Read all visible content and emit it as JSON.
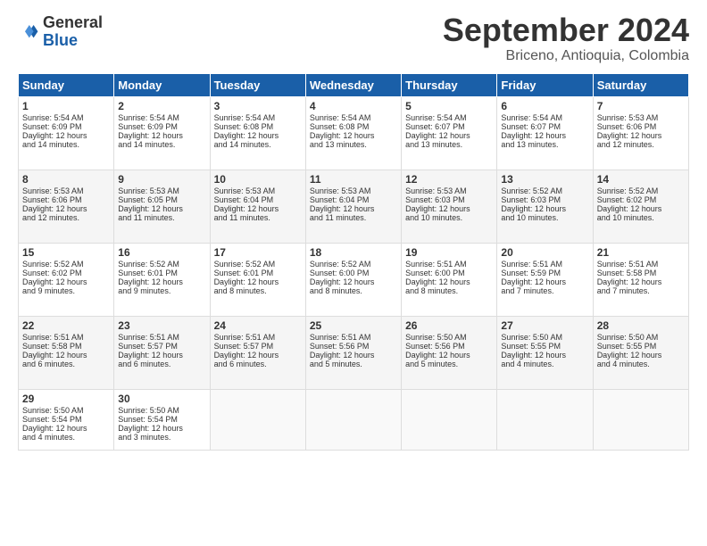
{
  "header": {
    "logo_line1": "General",
    "logo_line2": "Blue",
    "month": "September 2024",
    "location": "Briceno, Antioquia, Colombia"
  },
  "weekdays": [
    "Sunday",
    "Monday",
    "Tuesday",
    "Wednesday",
    "Thursday",
    "Friday",
    "Saturday"
  ],
  "weeks": [
    [
      {
        "day": "1",
        "lines": [
          "Sunrise: 5:54 AM",
          "Sunset: 6:09 PM",
          "Daylight: 12 hours",
          "and 14 minutes."
        ]
      },
      {
        "day": "2",
        "lines": [
          "Sunrise: 5:54 AM",
          "Sunset: 6:09 PM",
          "Daylight: 12 hours",
          "and 14 minutes."
        ]
      },
      {
        "day": "3",
        "lines": [
          "Sunrise: 5:54 AM",
          "Sunset: 6:08 PM",
          "Daylight: 12 hours",
          "and 14 minutes."
        ]
      },
      {
        "day": "4",
        "lines": [
          "Sunrise: 5:54 AM",
          "Sunset: 6:08 PM",
          "Daylight: 12 hours",
          "and 13 minutes."
        ]
      },
      {
        "day": "5",
        "lines": [
          "Sunrise: 5:54 AM",
          "Sunset: 6:07 PM",
          "Daylight: 12 hours",
          "and 13 minutes."
        ]
      },
      {
        "day": "6",
        "lines": [
          "Sunrise: 5:54 AM",
          "Sunset: 6:07 PM",
          "Daylight: 12 hours",
          "and 13 minutes."
        ]
      },
      {
        "day": "7",
        "lines": [
          "Sunrise: 5:53 AM",
          "Sunset: 6:06 PM",
          "Daylight: 12 hours",
          "and 12 minutes."
        ]
      }
    ],
    [
      {
        "day": "8",
        "lines": [
          "Sunrise: 5:53 AM",
          "Sunset: 6:06 PM",
          "Daylight: 12 hours",
          "and 12 minutes."
        ]
      },
      {
        "day": "9",
        "lines": [
          "Sunrise: 5:53 AM",
          "Sunset: 6:05 PM",
          "Daylight: 12 hours",
          "and 11 minutes."
        ]
      },
      {
        "day": "10",
        "lines": [
          "Sunrise: 5:53 AM",
          "Sunset: 6:04 PM",
          "Daylight: 12 hours",
          "and 11 minutes."
        ]
      },
      {
        "day": "11",
        "lines": [
          "Sunrise: 5:53 AM",
          "Sunset: 6:04 PM",
          "Daylight: 12 hours",
          "and 11 minutes."
        ]
      },
      {
        "day": "12",
        "lines": [
          "Sunrise: 5:53 AM",
          "Sunset: 6:03 PM",
          "Daylight: 12 hours",
          "and 10 minutes."
        ]
      },
      {
        "day": "13",
        "lines": [
          "Sunrise: 5:52 AM",
          "Sunset: 6:03 PM",
          "Daylight: 12 hours",
          "and 10 minutes."
        ]
      },
      {
        "day": "14",
        "lines": [
          "Sunrise: 5:52 AM",
          "Sunset: 6:02 PM",
          "Daylight: 12 hours",
          "and 10 minutes."
        ]
      }
    ],
    [
      {
        "day": "15",
        "lines": [
          "Sunrise: 5:52 AM",
          "Sunset: 6:02 PM",
          "Daylight: 12 hours",
          "and 9 minutes."
        ]
      },
      {
        "day": "16",
        "lines": [
          "Sunrise: 5:52 AM",
          "Sunset: 6:01 PM",
          "Daylight: 12 hours",
          "and 9 minutes."
        ]
      },
      {
        "day": "17",
        "lines": [
          "Sunrise: 5:52 AM",
          "Sunset: 6:01 PM",
          "Daylight: 12 hours",
          "and 8 minutes."
        ]
      },
      {
        "day": "18",
        "lines": [
          "Sunrise: 5:52 AM",
          "Sunset: 6:00 PM",
          "Daylight: 12 hours",
          "and 8 minutes."
        ]
      },
      {
        "day": "19",
        "lines": [
          "Sunrise: 5:51 AM",
          "Sunset: 6:00 PM",
          "Daylight: 12 hours",
          "and 8 minutes."
        ]
      },
      {
        "day": "20",
        "lines": [
          "Sunrise: 5:51 AM",
          "Sunset: 5:59 PM",
          "Daylight: 12 hours",
          "and 7 minutes."
        ]
      },
      {
        "day": "21",
        "lines": [
          "Sunrise: 5:51 AM",
          "Sunset: 5:58 PM",
          "Daylight: 12 hours",
          "and 7 minutes."
        ]
      }
    ],
    [
      {
        "day": "22",
        "lines": [
          "Sunrise: 5:51 AM",
          "Sunset: 5:58 PM",
          "Daylight: 12 hours",
          "and 6 minutes."
        ]
      },
      {
        "day": "23",
        "lines": [
          "Sunrise: 5:51 AM",
          "Sunset: 5:57 PM",
          "Daylight: 12 hours",
          "and 6 minutes."
        ]
      },
      {
        "day": "24",
        "lines": [
          "Sunrise: 5:51 AM",
          "Sunset: 5:57 PM",
          "Daylight: 12 hours",
          "and 6 minutes."
        ]
      },
      {
        "day": "25",
        "lines": [
          "Sunrise: 5:51 AM",
          "Sunset: 5:56 PM",
          "Daylight: 12 hours",
          "and 5 minutes."
        ]
      },
      {
        "day": "26",
        "lines": [
          "Sunrise: 5:50 AM",
          "Sunset: 5:56 PM",
          "Daylight: 12 hours",
          "and 5 minutes."
        ]
      },
      {
        "day": "27",
        "lines": [
          "Sunrise: 5:50 AM",
          "Sunset: 5:55 PM",
          "Daylight: 12 hours",
          "and 4 minutes."
        ]
      },
      {
        "day": "28",
        "lines": [
          "Sunrise: 5:50 AM",
          "Sunset: 5:55 PM",
          "Daylight: 12 hours",
          "and 4 minutes."
        ]
      }
    ],
    [
      {
        "day": "29",
        "lines": [
          "Sunrise: 5:50 AM",
          "Sunset: 5:54 PM",
          "Daylight: 12 hours",
          "and 4 minutes."
        ]
      },
      {
        "day": "30",
        "lines": [
          "Sunrise: 5:50 AM",
          "Sunset: 5:54 PM",
          "Daylight: 12 hours",
          "and 3 minutes."
        ]
      },
      null,
      null,
      null,
      null,
      null
    ]
  ]
}
